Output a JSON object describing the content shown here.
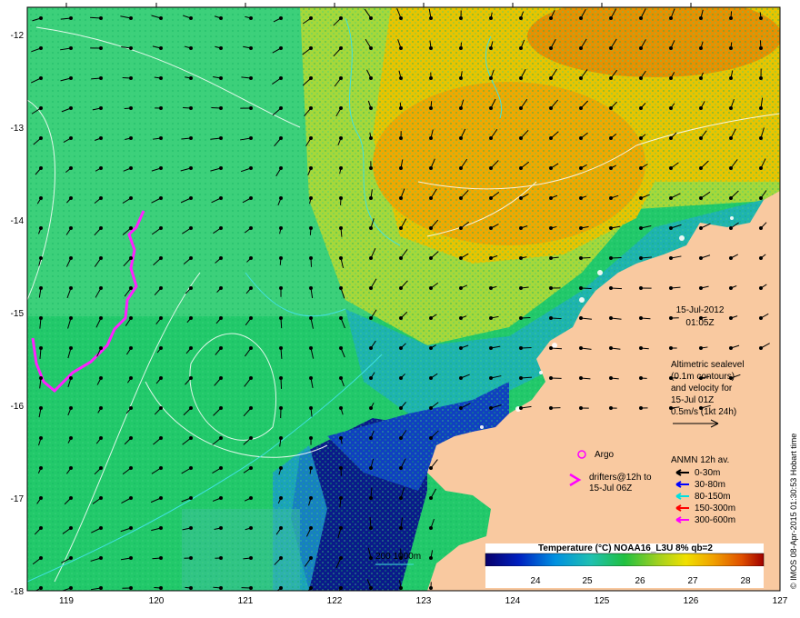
{
  "map": {
    "date": "15-Jul-2012",
    "time": "01:05Z",
    "altimetry_lines": [
      "Altimetric sealevel",
      "(0.1m contours)",
      "and velocity for",
      "15-Jul 01Z",
      "0.5m/s (1kt 24h)"
    ],
    "argo_label": "Argo",
    "drifters_lines": [
      "drifters@12h to",
      "15-Jul 06Z"
    ],
    "anmn_title": "ANMN 12h av.",
    "anmn_items": [
      {
        "label": "0-30m",
        "color": "#000000"
      },
      {
        "label": "30-80m",
        "color": "#0000ff"
      },
      {
        "label": "80-150m",
        "color": "#00e0e0"
      },
      {
        "label": "150-300m",
        "color": "#ff0000"
      },
      {
        "label": "300-600m",
        "color": "#ff00ff"
      }
    ],
    "bathy_label": "200  1000m",
    "colorbar_title": "Temperature (°C) NOAA16_L3U 8% qb=2",
    "colorbar_ticks": [
      "24",
      "25",
      "26",
      "27",
      "28"
    ],
    "lon_ticks": [
      "119",
      "120",
      "121",
      "122",
      "123",
      "124",
      "125",
      "126",
      "127"
    ],
    "lat_ticks": [
      "-12",
      "-13",
      "-14",
      "-15",
      "-16",
      "-17",
      "-18"
    ],
    "credit": "© IMOS 08-Apr-2015 01:30:53 Hobart time",
    "colors": {
      "land": "#f9c9a0",
      "sea_base": "#22c96a",
      "warm": "#f0b000",
      "cold": "#0a1a8a",
      "argo": "#ff00ff",
      "drifter_track": "#ff20ff",
      "contour": "#ffffff",
      "bathy": "#40e0e0"
    }
  }
}
